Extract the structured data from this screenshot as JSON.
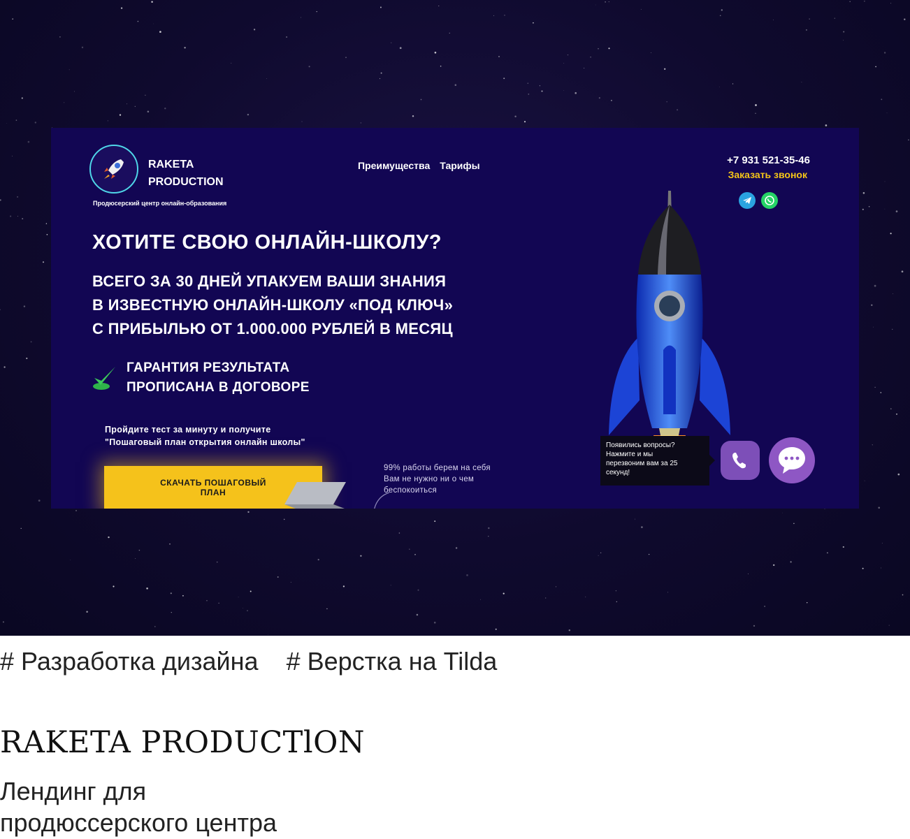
{
  "landing": {
    "logo_line1": "RAKETA",
    "logo_line2": "PRODUCTION",
    "logo_subtitle": "Продюсерский центр онлайн-образования",
    "nav": [
      "Преимущества",
      "Тарифы"
    ],
    "phone": "+7 931 521-35-46",
    "callback_label": "Заказать звонок",
    "headline": "ХОТИТЕ СВОЮ ОНЛАЙН-ШКОЛУ?",
    "subheadline": [
      "ВСЕГО ЗА 30 ДНЕЙ УПАКУЕМ ВАШИ ЗНАНИЯ",
      "В ИЗВЕСТНУЮ ОНЛАЙН-ШКОЛУ «ПОД КЛЮЧ»",
      "С ПРИБЫЛЬЮ ОТ 1.000.000 РУБЛЕЙ В МЕСЯЦ"
    ],
    "guarantee": [
      "ГАРАНТИЯ РЕЗУЛЬТАТА",
      "ПРОПИСАНА В ДОГОВОРЕ"
    ],
    "test_text": [
      "Пройдите тест за минуту и получите",
      "\"Пошаговый план открытия онлайн школы\""
    ],
    "cta_label": "СКАЧАТЬ ПОШАГОВЫЙ ПЛАН",
    "note": [
      "99% работы берем на себя",
      "Вам не нужно ни о чем",
      "беспокоиться"
    ],
    "tooltip": [
      "Появились вопросы?",
      "Нажмите и мы",
      "перезвоним вам за 25",
      "секунд!"
    ],
    "colors": {
      "bg": "#120653",
      "accent": "#f5c21b",
      "callback": "#f5c518",
      "viber": "#7d4fb8"
    }
  },
  "tags": [
    "# Разработка дизайна",
    "# Верстка на Tilda"
  ],
  "project": {
    "title": "RAKETA PRODUCTlON",
    "description": [
      "Лендинг для",
      "продюссерского центра"
    ]
  }
}
